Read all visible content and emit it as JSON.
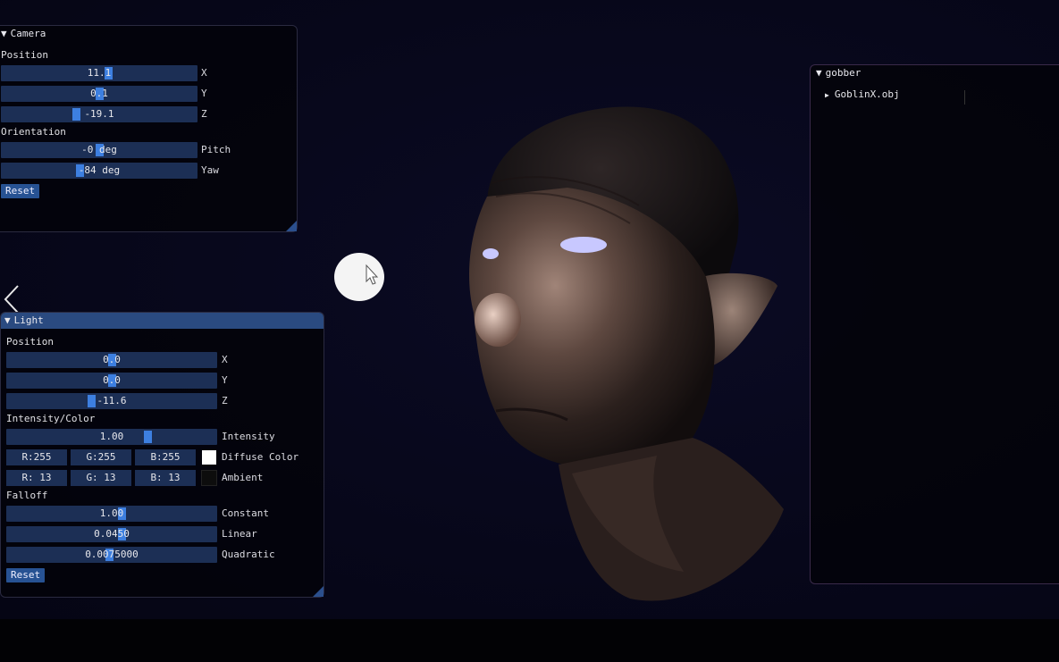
{
  "camera": {
    "title": "Camera",
    "position_label": "Position",
    "pos_x": {
      "value": "11.1",
      "axis": "X",
      "level": 0.55
    },
    "pos_y": {
      "value": "0.1",
      "axis": "Y",
      "level": 0.5
    },
    "pos_z": {
      "value": "-19.1",
      "axis": "Z",
      "level": 0.38
    },
    "orientation_label": "Orientation",
    "pitch": {
      "value": "-0 deg",
      "axis": "Pitch",
      "level": 0.5
    },
    "yaw": {
      "value": "-84 deg",
      "axis": "Yaw",
      "level": 0.4
    },
    "reset_label": "Reset"
  },
  "light": {
    "title": "Light",
    "position_label": "Position",
    "pos_x": {
      "value": "0.0",
      "axis": "X",
      "level": 0.5
    },
    "pos_y": {
      "value": "0.0",
      "axis": "Y",
      "level": 0.5
    },
    "pos_z": {
      "value": "-11.6",
      "axis": "Z",
      "level": 0.4
    },
    "intensity_label": "Intensity/Color",
    "intensity": {
      "value": "1.00",
      "axis": "Intensity",
      "level": 0.68
    },
    "diffuse": {
      "r": "R:255",
      "g": "G:255",
      "b": "B:255",
      "label": "Diffuse Color",
      "swatch": "#ffffff"
    },
    "ambient": {
      "r": "R: 13",
      "g": "G: 13",
      "b": "B: 13",
      "label": "Ambient",
      "swatch": "#0d0d0d"
    },
    "falloff_label": "Falloff",
    "constant": {
      "value": "1.00",
      "axis": "Constant",
      "level": 0.55
    },
    "linear": {
      "value": "0.0450",
      "axis": "Linear",
      "level": 0.55
    },
    "quadratic": {
      "value": "0.0075000",
      "axis": "Quadratic",
      "level": 0.49
    },
    "reset_label": "Reset"
  },
  "scene": {
    "title": "gobber",
    "items": [
      {
        "label": "GoblinX.obj"
      }
    ]
  },
  "colors": {
    "accent": "#3d7fe0",
    "slider_bg": "#1c2f55",
    "title_active": "#2a4a80"
  },
  "icons": [
    "collapse-triangle-icon",
    "expand-triangle-icon",
    "back-arrow-icon",
    "mouse-cursor-icon"
  ]
}
